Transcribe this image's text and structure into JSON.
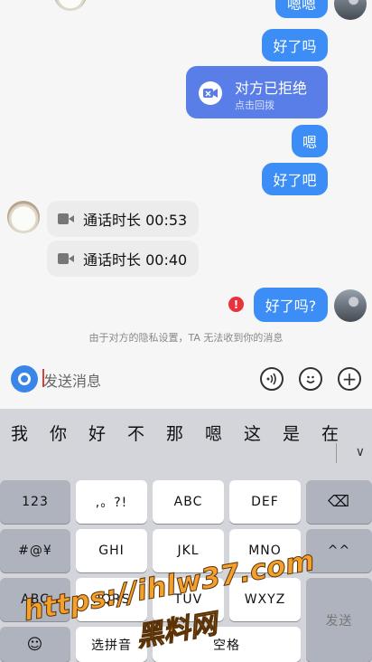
{
  "chat": {
    "top_partial": "嗯嗯",
    "msg_out_1": "好了吗",
    "call_card": {
      "title": "对方已拒绝",
      "subtitle": "点击回拨"
    },
    "msg_out_2": "嗯",
    "msg_out_3": "好了吧",
    "call_in_1": "通话时长 00:53",
    "call_in_2": "通话时长 00:40",
    "msg_out_failed": "好了吗?",
    "error_badge": "!",
    "privacy_notice": "由于对方的隐私设置，TA 无法收到你的消息"
  },
  "input": {
    "placeholder": "发送消息",
    "plus_glyph": "+"
  },
  "keyboard": {
    "candidates": [
      "我",
      "你",
      "好",
      "不",
      "那",
      "嗯",
      "这",
      "是",
      "在"
    ],
    "more_glyph": "∨",
    "row1": [
      "123",
      ",。?!",
      "ABC",
      "DEF",
      "⌫"
    ],
    "row2": [
      "#@¥",
      "GHI",
      "JKL",
      "MNO",
      "^^"
    ],
    "row3": [
      "ABC",
      "PQRS",
      "TUV",
      "WXYZ"
    ],
    "row4": [
      "☺",
      "选拼音",
      "空格"
    ],
    "send": "发送"
  },
  "watermark": {
    "line1": "https://ihlw37.com",
    "line2": "黑料网"
  }
}
